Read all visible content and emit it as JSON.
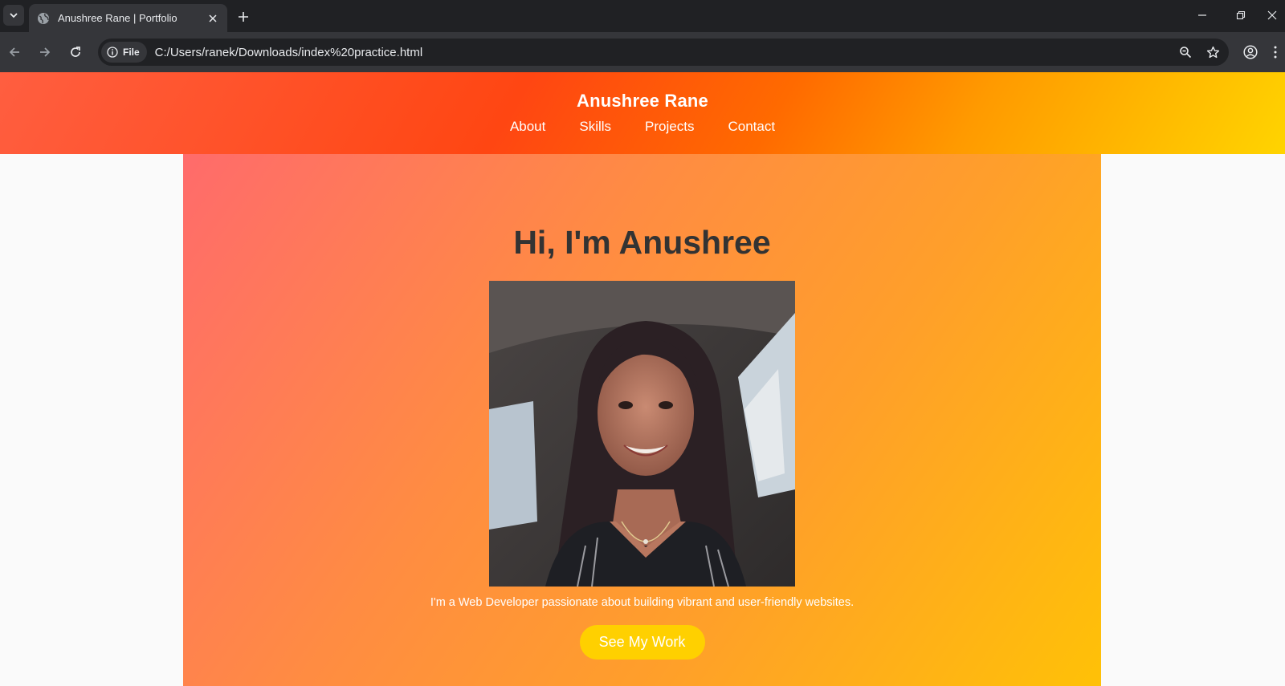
{
  "browser": {
    "tab_title": "Anushree Rane | Portfolio",
    "site_chip": "File",
    "url": "C:/Users/ranek/Downloads/index%20practice.html"
  },
  "header": {
    "brand": "Anushree Rane",
    "nav": [
      "About",
      "Skills",
      "Projects",
      "Contact"
    ]
  },
  "hero": {
    "heading": "Hi, I'm Anushree",
    "tagline": "I'm a Web Developer passionate about building vibrant and user-friendly websites.",
    "cta_label": "See My Work"
  },
  "colors": {
    "header_gradient": [
      "#ff5e40",
      "#ff4612",
      "#ff9a00",
      "#ffd400"
    ],
    "hero_gradient": [
      "#ff6b6b",
      "#ff8c42",
      "#ffc107"
    ],
    "heading_text": "#333333",
    "cta_background": "#ffd000"
  }
}
